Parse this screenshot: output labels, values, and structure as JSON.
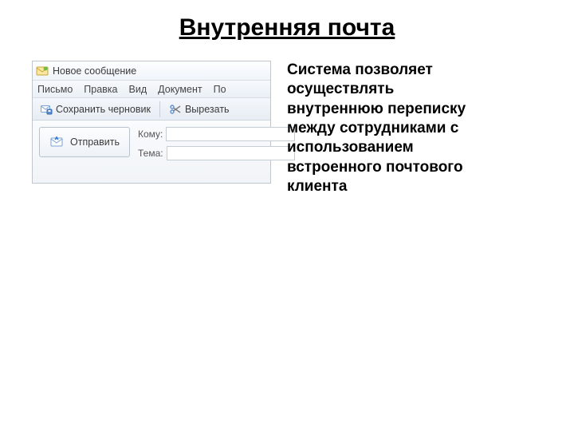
{
  "slide": {
    "title": "Внутренняя почта",
    "description": "Система позволяет осуществлять внутреннюю переписку между сотрудниками с использованием встроенного почтового клиента"
  },
  "mail": {
    "window_title": "Новое сообщение",
    "menu": {
      "letter": "Письмо",
      "edit": "Правка",
      "view": "Вид",
      "document": "Документ",
      "po": "По"
    },
    "toolbar": {
      "save_draft": "Сохранить черновик",
      "cut": "Вырезать"
    },
    "send": "Отправить",
    "fields": {
      "to_label": "Кому:",
      "subject_label": "Тема:",
      "to_value": "",
      "subject_value": ""
    }
  }
}
